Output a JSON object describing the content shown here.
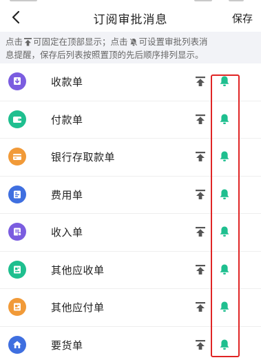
{
  "header": {
    "title": "订阅审批消息",
    "save_label": "保存"
  },
  "notice": {
    "seg1": "点击",
    "seg2": "可固定在顶部显示；点击",
    "seg3": "可设置审批列表消",
    "line2": "息提醒，保存后列表按照置顶的先后顺序排列显示。"
  },
  "items": [
    {
      "label": "收款单",
      "icon": "receipt-download-icon",
      "color": "#7b5de0"
    },
    {
      "label": "付款单",
      "icon": "wallet-icon",
      "color": "#1fbf8f"
    },
    {
      "label": "银行存取款单",
      "icon": "bank-card-icon",
      "color": "#f19a38"
    },
    {
      "label": "费用单",
      "icon": "expense-sheet-icon",
      "color": "#3f6fe0"
    },
    {
      "label": "收入单",
      "icon": "income-sheet-icon",
      "color": "#7b5de0"
    },
    {
      "label": "其他应收单",
      "icon": "other-receivable-icon",
      "color": "#1fbf8f"
    },
    {
      "label": "其他应付单",
      "icon": "other-payable-icon",
      "color": "#f19a38"
    },
    {
      "label": "要货单",
      "icon": "order-home-icon",
      "color": "#3f6fe0"
    }
  ],
  "colors": {
    "bell": "#1fbf8f",
    "pin": "#555555",
    "highlight": "#e02424"
  }
}
